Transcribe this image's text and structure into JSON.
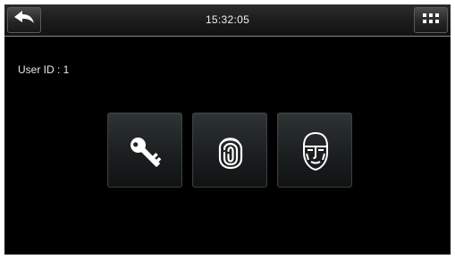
{
  "status_bar": {
    "time": "15:32:05",
    "back_icon": "back-arrow-icon",
    "menu_icon": "grid-menu-icon"
  },
  "user": {
    "id_label": "User ID : 1"
  },
  "verification_options": [
    {
      "name": "password",
      "icon": "key-icon"
    },
    {
      "name": "fingerprint",
      "icon": "fingerprint-icon"
    },
    {
      "name": "face",
      "icon": "face-icon"
    }
  ],
  "colors": {
    "background": "#000000",
    "topbar": "#1a1a1a",
    "tile": "#1f2324",
    "icon": "#ffffff"
  }
}
